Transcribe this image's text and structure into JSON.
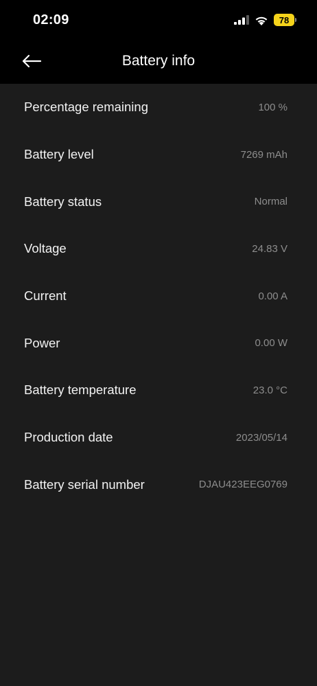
{
  "status_bar": {
    "time": "02:09",
    "battery_percent": "78",
    "battery_color": "#f5d31b"
  },
  "header": {
    "title": "Battery info",
    "back_icon": "back-arrow-icon"
  },
  "rows": [
    {
      "label": "Percentage remaining",
      "value": "100 %"
    },
    {
      "label": "Battery level",
      "value": "7269 mAh"
    },
    {
      "label": "Battery status",
      "value": "Normal"
    },
    {
      "label": "Voltage",
      "value": "24.83 V"
    },
    {
      "label": "Current",
      "value": "0.00 A"
    },
    {
      "label": "Power",
      "value": "0.00 W"
    },
    {
      "label": "Battery temperature",
      "value": "23.0 °C"
    },
    {
      "label": "Production date",
      "value": "2023/05/14"
    },
    {
      "label": "Battery serial number",
      "value": "DJAU423EEG0769"
    }
  ]
}
